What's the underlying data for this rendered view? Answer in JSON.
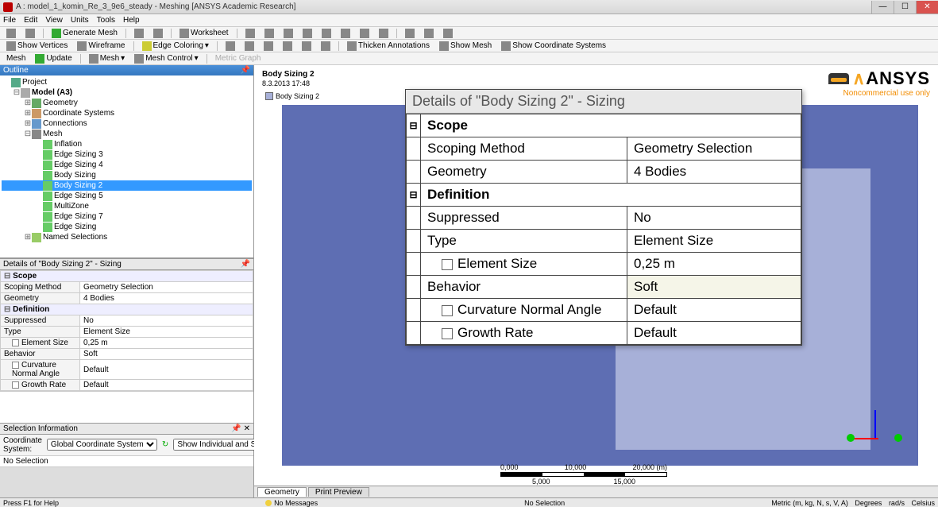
{
  "title": "A : model_1_komin_Re_3_9e6_steady - Meshing [ANSYS Academic Research]",
  "menu": [
    "File",
    "Edit",
    "View",
    "Units",
    "Tools",
    "Help"
  ],
  "toolbar1": {
    "generate": "Generate Mesh",
    "worksheet": "Worksheet"
  },
  "toolbar2": {
    "showVertices": "Show Vertices",
    "wireframe": "Wireframe",
    "edgeColoring": "Edge Coloring",
    "thicken": "Thicken Annotations",
    "showMesh": "Show Mesh",
    "showCoord": "Show Coordinate Systems"
  },
  "toolbar3": {
    "mesh": "Mesh",
    "update": "Update",
    "meshBtn": "Mesh",
    "meshControl": "Mesh Control",
    "metric": "Metric Graph"
  },
  "outline": {
    "header": "Outline",
    "tree": {
      "project": "Project",
      "model": "Model (A3)",
      "geometry": "Geometry",
      "coord": "Coordinate Systems",
      "connections": "Connections",
      "mesh": "Mesh",
      "meshItems": [
        "Inflation",
        "Edge Sizing 3",
        "Edge Sizing 4",
        "Body Sizing",
        "Body Sizing 2",
        "Edge Sizing 5",
        "MultiZone",
        "Edge Sizing 7",
        "Edge Sizing"
      ],
      "named": "Named Selections"
    }
  },
  "details": {
    "header": "Details of \"Body Sizing 2\" - Sizing",
    "scope": {
      "label": "Scope",
      "scopingMethod": {
        "k": "Scoping Method",
        "v": "Geometry Selection"
      },
      "geometry": {
        "k": "Geometry",
        "v": "4 Bodies"
      }
    },
    "definition": {
      "label": "Definition",
      "suppressed": {
        "k": "Suppressed",
        "v": "No"
      },
      "type": {
        "k": "Type",
        "v": "Element Size"
      },
      "elementSize": {
        "k": "Element Size",
        "v": "0,25 m"
      },
      "behavior": {
        "k": "Behavior",
        "v": "Soft"
      },
      "curvature": {
        "k": "Curvature Normal Angle",
        "v": "Default"
      },
      "growth": {
        "k": "Growth Rate",
        "v": "Default"
      }
    }
  },
  "selinfo": {
    "header": "Selection Information",
    "coordLabel": "Coordinate System:",
    "coordValue": "Global Coordinate System",
    "showLabel": "Show Individual and Summary",
    "noSel": "No Selection"
  },
  "viewport": {
    "title": "Body Sizing 2",
    "timestamp": "8.3.2013 17:48",
    "legend": "Body Sizing 2",
    "brand": {
      "name": "ANSYS",
      "tag": "Noncommercial use only"
    },
    "scale": {
      "top": [
        "0,000",
        "10,000",
        "20,000 (m)"
      ],
      "bot": [
        "5,000",
        "15,000"
      ]
    },
    "tabs": [
      "Geometry",
      "Print Preview"
    ]
  },
  "overlay": {
    "title": "Details of \"Body Sizing 2\" - Sizing",
    "scope": "Scope",
    "scopingMethod": {
      "k": "Scoping Method",
      "v": "Geometry Selection"
    },
    "geometry": {
      "k": "Geometry",
      "v": "4 Bodies"
    },
    "definition": "Definition",
    "suppressed": {
      "k": "Suppressed",
      "v": "No"
    },
    "type": {
      "k": "Type",
      "v": "Element Size"
    },
    "elementSize": {
      "k": "Element Size",
      "v": "0,25 m"
    },
    "behavior": {
      "k": "Behavior",
      "v": "Soft"
    },
    "curvature": {
      "k": "Curvature Normal Angle",
      "v": "Default"
    },
    "growth": {
      "k": "Growth Rate",
      "v": "Default"
    }
  },
  "status": {
    "help": "Press F1 for Help",
    "msg": "No Messages",
    "sel": "No Selection",
    "metric": "Metric (m, kg, N, s, V, A)",
    "deg": "Degrees",
    "rads": "rad/s",
    "cel": "Celsius"
  }
}
